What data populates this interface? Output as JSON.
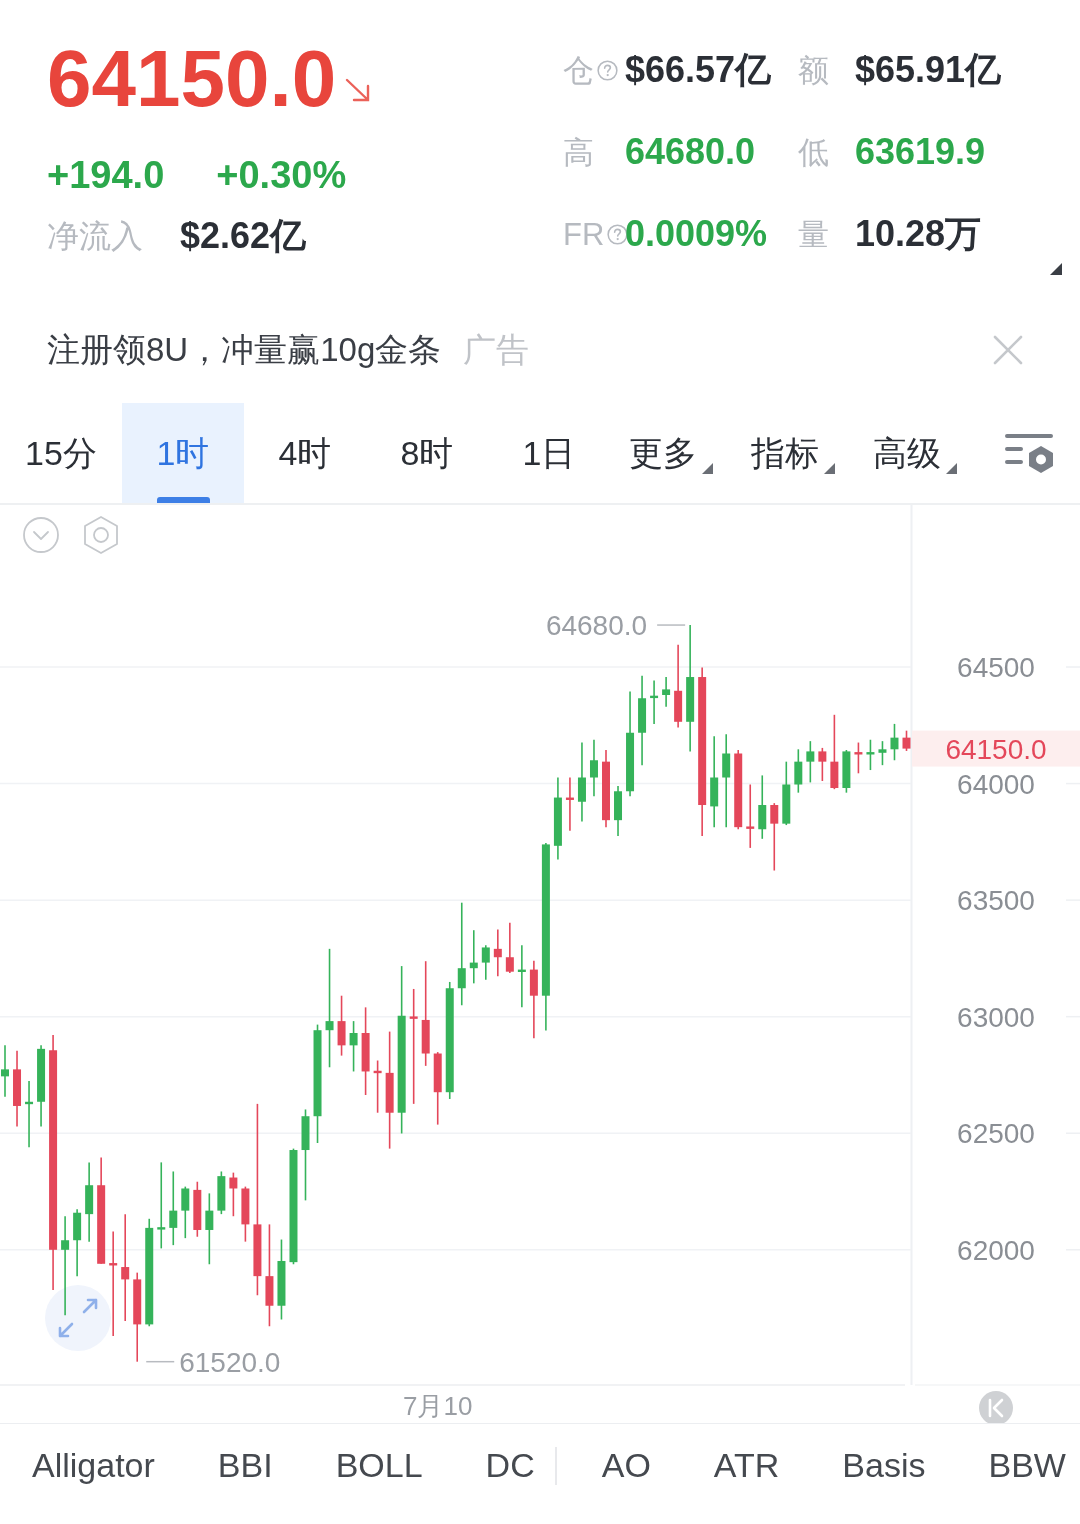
{
  "quote": {
    "price": "64150.0",
    "falling": true,
    "change": "+194.0",
    "change_pct": "+0.30%",
    "inflow_label": "净流入",
    "inflow_value": "$2.62亿"
  },
  "stats": [
    {
      "label": "仓",
      "help": true,
      "value": "$66.57亿",
      "color": "#2b2f36"
    },
    {
      "label": "额",
      "help": false,
      "value": "$65.91亿",
      "color": "#2b2f36"
    },
    {
      "label": "高",
      "help": false,
      "value": "64680.0",
      "color": "#2ca84c"
    },
    {
      "label": "低",
      "help": false,
      "value": "63619.9",
      "color": "#2ca84c"
    },
    {
      "label": "FR",
      "help": true,
      "value": "0.0009%",
      "color": "#2ca84c"
    },
    {
      "label": "量",
      "help": false,
      "value": "10.28万",
      "color": "#2b2f36"
    }
  ],
  "banner": {
    "text": "注册领8U，冲量赢10g金条",
    "tag": "广告"
  },
  "tabs": [
    {
      "label": "15分",
      "selected": false,
      "dropdown": false
    },
    {
      "label": "1时",
      "selected": true,
      "dropdown": false
    },
    {
      "label": "4时",
      "selected": false,
      "dropdown": false
    },
    {
      "label": "8时",
      "selected": false,
      "dropdown": false
    },
    {
      "label": "1日",
      "selected": false,
      "dropdown": false
    },
    {
      "label": "更多",
      "selected": false,
      "dropdown": true
    },
    {
      "label": "指标",
      "selected": false,
      "dropdown": true
    },
    {
      "label": "高级",
      "selected": false,
      "dropdown": true
    }
  ],
  "chart": {
    "high_label": "64680.0",
    "low_label": "61520.0",
    "last_price": "64150.0",
    "chart_data": {
      "type": "candlestick",
      "grid": true,
      "categories": [
        null,
        null,
        null,
        null,
        null,
        null,
        null,
        null,
        null,
        null,
        null,
        null,
        null,
        null,
        null,
        null,
        null,
        null,
        null,
        null,
        null,
        null,
        null,
        null,
        null,
        null,
        null,
        null,
        null,
        null,
        null,
        null,
        null,
        null,
        null,
        null,
        "7月10",
        null,
        null,
        null,
        null,
        null,
        null,
        null,
        null,
        null,
        null,
        null,
        null,
        null,
        null,
        null,
        null,
        null,
        null,
        null,
        null,
        null,
        null,
        null,
        null,
        null,
        null,
        null,
        null,
        null,
        null,
        null,
        null,
        null,
        null,
        null,
        null,
        null,
        null,
        null
      ],
      "ohlc": [
        [
          62744,
          62877,
          62656,
          62774
        ],
        [
          62774,
          62854,
          62529,
          62617
        ],
        [
          62626,
          62724,
          62440,
          62635
        ],
        [
          62635,
          62877,
          62529,
          62862
        ],
        [
          62856,
          62921,
          61828,
          62000
        ],
        [
          62000,
          62144,
          61719,
          62041
        ],
        [
          62041,
          62174,
          61887,
          62159
        ],
        [
          62153,
          62375,
          62035,
          62277
        ],
        [
          62277,
          62396,
          61940,
          61940
        ],
        [
          61943,
          62079,
          61630,
          61935
        ],
        [
          61926,
          62153,
          61695,
          61873
        ],
        [
          61873,
          61902,
          61520,
          61680
        ],
        [
          61680,
          62133,
          61672,
          62094
        ],
        [
          62088,
          62375,
          62006,
          62097
        ],
        [
          62094,
          62336,
          62020,
          62168
        ],
        [
          62168,
          62271,
          62050,
          62263
        ],
        [
          62257,
          62292,
          62056,
          62085
        ],
        [
          62085,
          62242,
          61938,
          62168
        ],
        [
          62168,
          62336,
          62153,
          62316
        ],
        [
          62310,
          62331,
          62144,
          62263
        ],
        [
          62263,
          62271,
          62035,
          62109
        ],
        [
          62109,
          62626,
          61805,
          61887
        ],
        [
          61887,
          62109,
          61672,
          61760
        ],
        [
          61760,
          62044,
          61701,
          61952
        ],
        [
          61947,
          62434,
          61938,
          62428
        ],
        [
          62428,
          62602,
          62212,
          62573
        ],
        [
          62573,
          62966,
          62458,
          62942
        ],
        [
          62942,
          63291,
          62783,
          62981
        ],
        [
          62981,
          63090,
          62833,
          62877
        ],
        [
          62877,
          62981,
          62765,
          62930
        ],
        [
          62930,
          63040,
          62664,
          62765
        ],
        [
          62768,
          62812,
          62588,
          62759
        ],
        [
          62759,
          62936,
          62434,
          62588
        ],
        [
          62588,
          63217,
          62499,
          63004
        ],
        [
          63001,
          63119,
          62626,
          62992
        ],
        [
          62986,
          63238,
          62789,
          62842
        ],
        [
          62842,
          62848,
          62537,
          62676
        ],
        [
          62676,
          63149,
          62647,
          63122
        ],
        [
          63122,
          63489,
          63049,
          63208
        ],
        [
          63208,
          63371,
          63143,
          63232
        ],
        [
          63232,
          63306,
          63158,
          63297
        ],
        [
          63291,
          63374,
          63173,
          63255
        ],
        [
          63255,
          63403,
          63187,
          63193
        ],
        [
          63193,
          63306,
          63040,
          63202
        ],
        [
          63202,
          63240,
          62907,
          63090
        ],
        [
          63090,
          63745,
          62941,
          63739
        ],
        [
          63733,
          64026,
          63674,
          63940
        ],
        [
          63940,
          64026,
          63798,
          63931
        ],
        [
          63922,
          64176,
          63837,
          64026
        ],
        [
          64026,
          64188,
          63946,
          64100
        ],
        [
          64094,
          64144,
          63813,
          63843
        ],
        [
          63843,
          63990,
          63775,
          63967
        ],
        [
          63967,
          64395,
          63946,
          64218
        ],
        [
          64218,
          64463,
          64079,
          64366
        ],
        [
          64368,
          64442,
          64256,
          64377
        ],
        [
          64380,
          64457,
          64330,
          64404
        ],
        [
          64398,
          64596,
          64241,
          64265
        ],
        [
          64265,
          64680,
          64138,
          64457
        ],
        [
          64457,
          64498,
          63775,
          63908
        ],
        [
          63902,
          64203,
          63813,
          64026
        ],
        [
          64026,
          64212,
          63813,
          64129
        ],
        [
          64129,
          64144,
          63804,
          63813
        ],
        [
          63816,
          63996,
          63724,
          63807
        ],
        [
          63804,
          64035,
          63763,
          63908
        ],
        [
          63908,
          63916,
          63627,
          63828
        ],
        [
          63828,
          64094,
          63822,
          63996
        ],
        [
          63996,
          64147,
          63961,
          64094
        ],
        [
          64094,
          64182,
          64005,
          64138
        ],
        [
          64138,
          64153,
          64011,
          64094
        ],
        [
          64094,
          64295,
          63976,
          63981
        ],
        [
          63981,
          64144,
          63961,
          64138
        ],
        [
          64135,
          64176,
          64044,
          64126
        ],
        [
          64126,
          64188,
          64058,
          64135
        ],
        [
          64132,
          64182,
          64079,
          64147
        ],
        [
          64147,
          64256,
          64100,
          64197
        ],
        [
          64197,
          64227,
          64140,
          64150
        ]
      ],
      "ylim": [
        61420,
        65195
      ],
      "yticks": [
        64500,
        64000,
        63500,
        63000,
        62500,
        62000
      ]
    }
  },
  "indicators": {
    "main": [
      "Alligator",
      "BBI",
      "BOLL",
      "DC"
    ],
    "sub": [
      "AO",
      "ATR",
      "Basis",
      "BBW"
    ]
  }
}
